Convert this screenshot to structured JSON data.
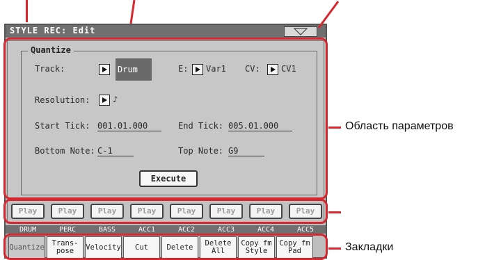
{
  "title": "STYLE REC: Edit",
  "group_title": "Quantize",
  "track": {
    "label": "Track:",
    "value": "Drum"
  },
  "e": {
    "label": "E:",
    "value": "Var1"
  },
  "cv": {
    "label": "CV:",
    "value": "CV1"
  },
  "resolution": {
    "label": "Resolution:",
    "value": "♪"
  },
  "start_tick": {
    "label": "Start Tick:",
    "value": "001.01.000"
  },
  "end_tick": {
    "label": "End Tick:",
    "value": "005.01.000"
  },
  "bottom_note": {
    "label": "Bottom Note:",
    "value": "C-1"
  },
  "top_note": {
    "label": "Top Note:",
    "value": "G9"
  },
  "execute_label": "Execute",
  "play_label": "Play",
  "tracks": [
    "DRUM",
    "PERC",
    "BASS",
    "ACC1",
    "ACC2",
    "ACC3",
    "ACC4",
    "ACC5"
  ],
  "tabs": [
    {
      "label": "Quantize",
      "active": true
    },
    {
      "label": "Trans-\npose"
    },
    {
      "label": "Velocity"
    },
    {
      "label": "Cut"
    },
    {
      "label": "Delete"
    },
    {
      "label": "Delete\nAll"
    },
    {
      "label": "Copy fm\nStyle"
    },
    {
      "label": "Copy fm\nPad"
    }
  ],
  "callouts": {
    "params": "Область параметров",
    "tabs": "Закладки"
  },
  "accent_color": "#d8262e"
}
